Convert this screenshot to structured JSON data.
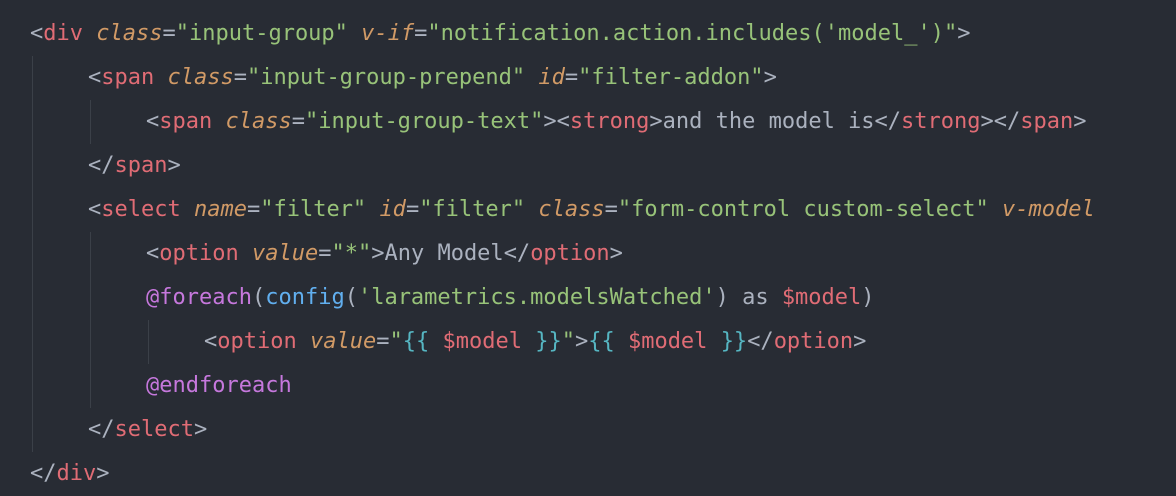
{
  "editor": {
    "theme": "one-dark",
    "colors": {
      "background": "#282c34",
      "tag": "#e06c75",
      "attribute": "#d19a66",
      "string": "#98c379",
      "punctuation": "#abb2bf",
      "directive": "#c678dd",
      "function": "#61afef",
      "variable": "#e06c75",
      "blade_brace": "#56b6c2"
    },
    "lines": [
      [
        [
          "punct",
          "<"
        ],
        [
          "tag",
          "div"
        ],
        [
          "text",
          " "
        ],
        [
          "attr",
          "class"
        ],
        [
          "punct",
          "="
        ],
        [
          "str",
          "\"input-group\""
        ],
        [
          "text",
          " "
        ],
        [
          "attr",
          "v-if"
        ],
        [
          "punct",
          "="
        ],
        [
          "str",
          "\"notification.action.includes('model_')\""
        ],
        [
          "punct",
          ">"
        ]
      ],
      [
        [
          "punct",
          "<"
        ],
        [
          "tag",
          "span"
        ],
        [
          "text",
          " "
        ],
        [
          "attr",
          "class"
        ],
        [
          "punct",
          "="
        ],
        [
          "str",
          "\"input-group-prepend\""
        ],
        [
          "text",
          " "
        ],
        [
          "attr",
          "id"
        ],
        [
          "punct",
          "="
        ],
        [
          "str",
          "\"filter-addon\""
        ],
        [
          "punct",
          ">"
        ]
      ],
      [
        [
          "punct",
          "<"
        ],
        [
          "tag",
          "span"
        ],
        [
          "text",
          " "
        ],
        [
          "attr",
          "class"
        ],
        [
          "punct",
          "="
        ],
        [
          "str",
          "\"input-group-text\""
        ],
        [
          "punct",
          "><"
        ],
        [
          "tag",
          "strong"
        ],
        [
          "punct",
          ">"
        ],
        [
          "text",
          "and the model is"
        ],
        [
          "punct",
          "</"
        ],
        [
          "tag",
          "strong"
        ],
        [
          "punct",
          "></"
        ],
        [
          "tag",
          "span"
        ],
        [
          "punct",
          ">"
        ]
      ],
      [
        [
          "punct",
          "</"
        ],
        [
          "tag",
          "span"
        ],
        [
          "punct",
          ">"
        ]
      ],
      [
        [
          "punct",
          "<"
        ],
        [
          "tag",
          "select"
        ],
        [
          "text",
          " "
        ],
        [
          "attr",
          "name"
        ],
        [
          "punct",
          "="
        ],
        [
          "str",
          "\"filter\""
        ],
        [
          "text",
          " "
        ],
        [
          "attr",
          "id"
        ],
        [
          "punct",
          "="
        ],
        [
          "str",
          "\"filter\""
        ],
        [
          "text",
          " "
        ],
        [
          "attr",
          "class"
        ],
        [
          "punct",
          "="
        ],
        [
          "str",
          "\"form-control custom-select\""
        ],
        [
          "text",
          " "
        ],
        [
          "attr",
          "v-model"
        ]
      ],
      [
        [
          "punct",
          "<"
        ],
        [
          "tag",
          "option"
        ],
        [
          "text",
          " "
        ],
        [
          "attr",
          "value"
        ],
        [
          "punct",
          "="
        ],
        [
          "str",
          "\"*\""
        ],
        [
          "punct",
          ">"
        ],
        [
          "text",
          "Any Model"
        ],
        [
          "punct",
          "</"
        ],
        [
          "tag",
          "option"
        ],
        [
          "punct",
          ">"
        ]
      ],
      [
        [
          "directive",
          "@foreach"
        ],
        [
          "punct",
          "("
        ],
        [
          "func",
          "config"
        ],
        [
          "punct",
          "("
        ],
        [
          "str",
          "'larametrics.modelsWatched'"
        ],
        [
          "punct",
          ")"
        ],
        [
          "text",
          " as "
        ],
        [
          "var",
          "$model"
        ],
        [
          "punct",
          ")"
        ]
      ],
      [
        [
          "punct",
          "<"
        ],
        [
          "tag",
          "option"
        ],
        [
          "text",
          " "
        ],
        [
          "attr",
          "value"
        ],
        [
          "punct",
          "="
        ],
        [
          "str",
          "\""
        ],
        [
          "blade",
          "{{"
        ],
        [
          "text",
          " "
        ],
        [
          "var",
          "$model"
        ],
        [
          "text",
          " "
        ],
        [
          "blade",
          "}}"
        ],
        [
          "str",
          "\""
        ],
        [
          "punct",
          ">"
        ],
        [
          "blade",
          "{{"
        ],
        [
          "text",
          " "
        ],
        [
          "var",
          "$model"
        ],
        [
          "text",
          " "
        ],
        [
          "blade",
          "}}"
        ],
        [
          "punct",
          "</"
        ],
        [
          "tag",
          "option"
        ],
        [
          "punct",
          ">"
        ]
      ],
      [
        [
          "directive",
          "@endforeach"
        ]
      ],
      [
        [
          "punct",
          "</"
        ],
        [
          "tag",
          "select"
        ],
        [
          "punct",
          ">"
        ]
      ],
      [
        [
          "punct",
          "</"
        ],
        [
          "tag",
          "div"
        ],
        [
          "punct",
          ">"
        ]
      ]
    ]
  }
}
